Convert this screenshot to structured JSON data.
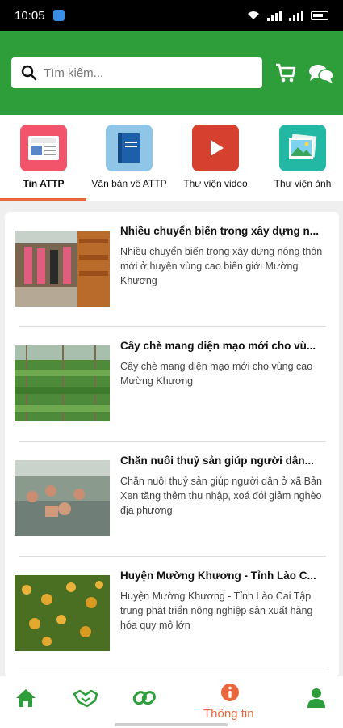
{
  "status_bar": {
    "time": "10:05"
  },
  "search": {
    "placeholder": "Tìm kiếm..."
  },
  "tabs": [
    {
      "label": "Tin ATTP",
      "icon": "newspaper-icon",
      "active": true
    },
    {
      "label": "Văn bản về ATTP",
      "icon": "book-icon",
      "active": false
    },
    {
      "label": "Thư viện video",
      "icon": "play-icon",
      "active": false
    },
    {
      "label": "Thư viện ảnh",
      "icon": "image-gallery-icon",
      "active": false
    }
  ],
  "articles": [
    {
      "title": "Nhiều chuyển biến trong xây dựng n...",
      "desc": "Nhiều chuyển biến trong xây dựng nông thôn mới ở huyện vùng cao biên giới Mường Khương"
    },
    {
      "title": "Cây chè mang diện mạo mới cho vù...",
      "desc": "Cây chè mang diện mạo mới cho vùng cao Mường Khương"
    },
    {
      "title": "Chăn nuôi thuỷ sản giúp người dân...",
      "desc": "Chăn nuôi thuỷ sản giúp người dân ở xã Bản Xen tăng thêm thu nhập, xoá đói giảm nghèo địa phương"
    },
    {
      "title": "Huyện Mường Khương - Tỉnh Lào C...",
      "desc": "Huyện Mường Khương - Tỉnh Lào Cai Tập trung phát triển nông nghiệp sản xuất hàng hóa quy mô lớn"
    }
  ],
  "bottom_nav": {
    "active_label": "Thông tin",
    "items": [
      "home-icon",
      "handshake-icon",
      "link-icon",
      "info-icon",
      "user-icon"
    ]
  },
  "colors": {
    "brand_green": "#2e9e3a",
    "accent_orange": "#e8673d"
  }
}
